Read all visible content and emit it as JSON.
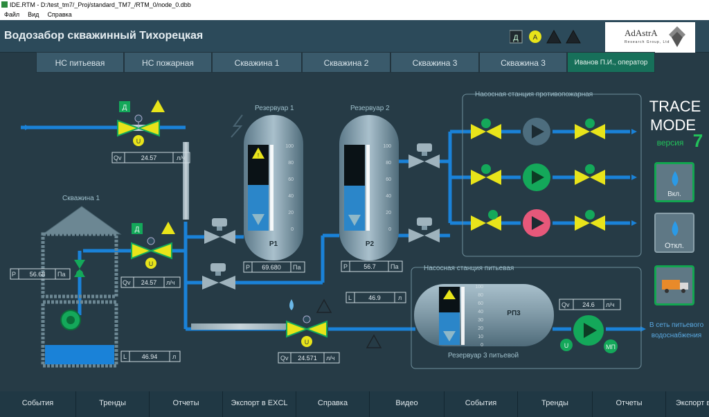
{
  "window": {
    "title": "IDE.RTM - D:/test_tm7/_Proj/standard_TM7_/RTM_0/node_0.dbb"
  },
  "menu": {
    "items": [
      "Файл",
      "Вид",
      "Справка"
    ]
  },
  "header": {
    "title": "Водозабор скважинный Тихорецкая",
    "status_d": "Д",
    "status_a": "A",
    "logo_name": "AdAstrA",
    "logo_sub": "Research Group, Ltd"
  },
  "tabs": [
    "НС питьевая",
    "НС пожарная",
    "Скважина 1",
    "Скважина 2",
    "Скважина 3",
    "Скважина 3"
  ],
  "user": "Иванов П.И., оператор",
  "scheme": {
    "reservoir1": {
      "title": "Резервуар 1",
      "name": "P1",
      "p_label": "P",
      "p_value": "69.680",
      "p_unit": "Па"
    },
    "reservoir2": {
      "title": "Резервуар 2",
      "name": "P2",
      "p_label": "P",
      "p_value": "56.7",
      "p_unit": "Па"
    },
    "reservoir3": {
      "title": "Резервуар 3 питьевой",
      "name": "РП3",
      "l_label": "L",
      "l_value": "46.9",
      "l_unit": "л",
      "qv_label": "Qv",
      "qv_value": "24.6",
      "qv_unit": "л/ч"
    },
    "scale_ticks": [
      "100",
      "80",
      "60",
      "40",
      "20",
      "0"
    ],
    "scale_ticks_small": [
      "100",
      "80",
      "60",
      "40",
      "30",
      "20",
      "10",
      "0"
    ],
    "well1": {
      "title": "Скважина 1",
      "p_label": "P",
      "p_value": "56.68",
      "p_unit": "Па",
      "l_label": "L",
      "l_value": "46.94",
      "l_unit": "л"
    },
    "valve_top": {
      "mode": "Д",
      "qv_label": "Qv",
      "qv_value": "24.57",
      "qv_unit": "л/ч",
      "u": "U"
    },
    "valve_mid": {
      "mode": "Д",
      "qv_label": "Qv",
      "qv_value": "24.57",
      "qv_unit": "л/ч",
      "u": "U"
    },
    "valve_bottom": {
      "qv_label": "Qv",
      "qv_value": "24.571",
      "qv_unit": "л/ч",
      "u": "U"
    },
    "fire_station": {
      "title": "Насосная станция противопожарная"
    },
    "drink_station": {
      "title": "Насосная станция питьевая",
      "u": "U",
      "mp": "МП"
    },
    "outlet": {
      "line1": "В сеть питьевого",
      "line2": "водоснабжения"
    },
    "trace_mode": {
      "line1": "TRACE",
      "line2": "MODE",
      "ver": "версия",
      "num": "7"
    },
    "side": {
      "on_label": "Вкл.",
      "off_label": "Откл."
    }
  },
  "bottom_bar": [
    "События",
    "Тренды",
    "Отчеты",
    "Экспорт в EXCL",
    "Справка",
    "Видео",
    "События",
    "Тренды",
    "Отчеты",
    "Экспорт в"
  ],
  "colors": {
    "pipe": "#1a82d8",
    "valve": "#e8e41a",
    "ok": "#14a85a",
    "warn": "#e8e41a",
    "alarm_pump": "#e6587a",
    "idle_pump": "#4d6d7e",
    "bg": "#263b46"
  }
}
